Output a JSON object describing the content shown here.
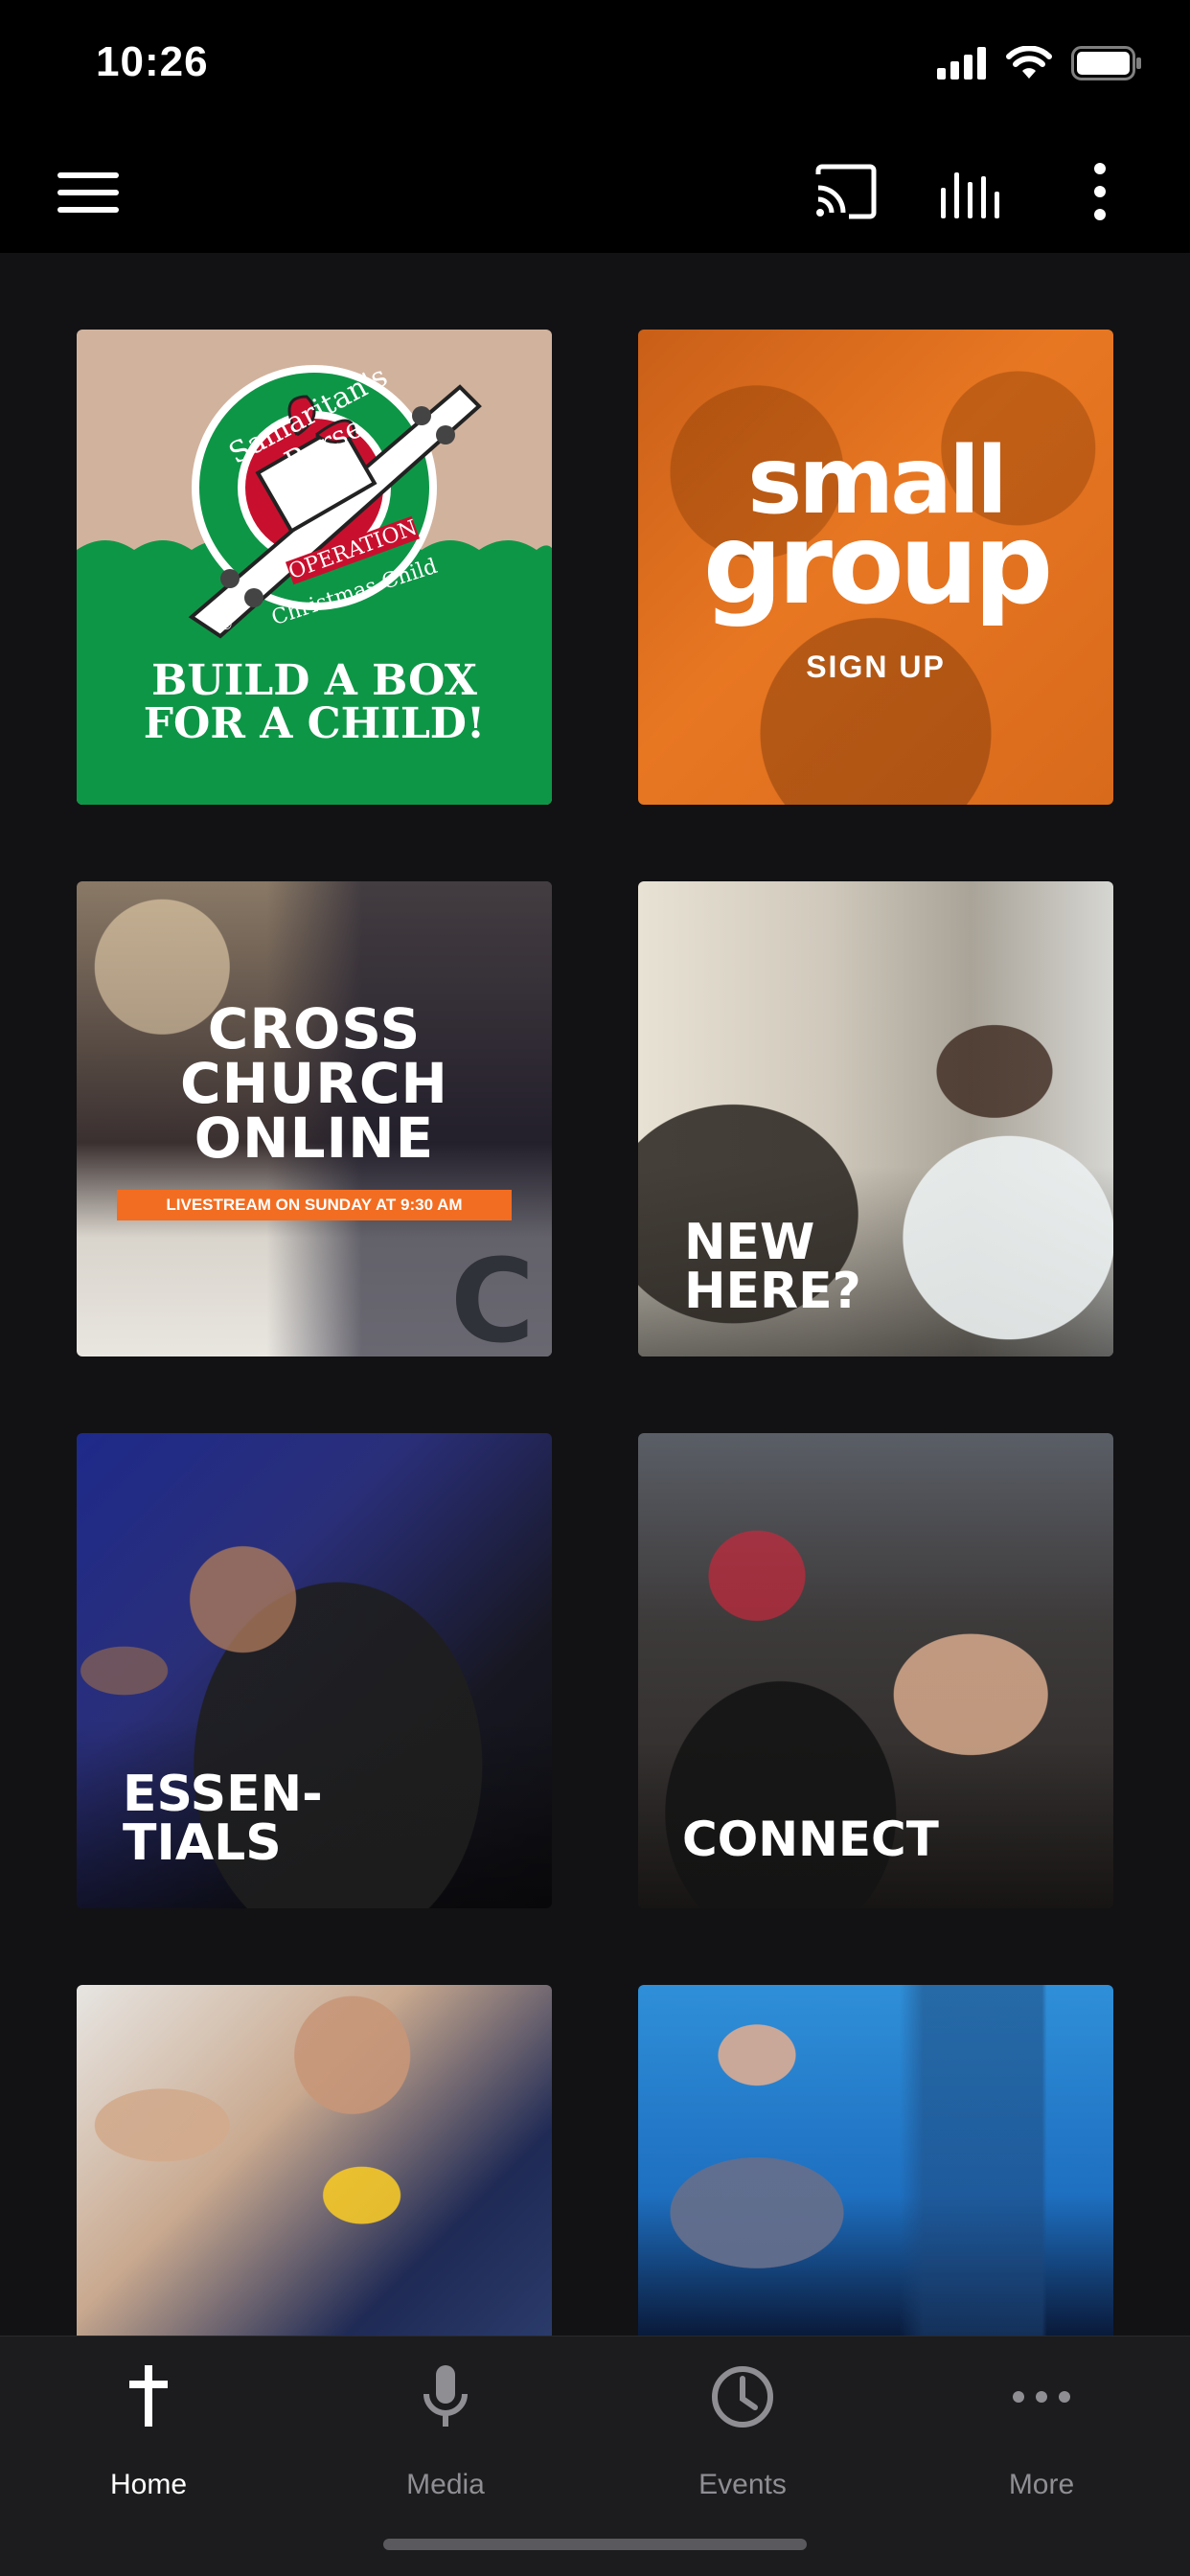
{
  "status_bar": {
    "time": "10:26"
  },
  "app_bar": {
    "menu_icon": "hamburger-menu-icon",
    "cast_icon": "cast-icon",
    "audio_icon": "audio-bars-icon",
    "more_icon": "vertical-dots-icon"
  },
  "tiles": [
    {
      "id": "operation-christmas-child",
      "arc_top": "Samaritan's Purse",
      "arc_mid": "OPERATION",
      "arc_bottom": "Christmas Child",
      "reg": "®",
      "tagline": "BUILD A BOX\nFOR A CHILD!"
    },
    {
      "id": "small-group",
      "line1": "small",
      "line2": "group",
      "sub": "SIGN UP"
    },
    {
      "id": "cross-church-online",
      "title": "CROSS\nCHURCH\nONLINE",
      "banner": "LIVESTREAM ON SUNDAY AT 9:30 AM"
    },
    {
      "id": "new-here",
      "title": "NEW\nHERE?"
    },
    {
      "id": "essentials",
      "title": "ESSEN-\nTIALS"
    },
    {
      "id": "connect",
      "title": "CONNECT"
    },
    {
      "id": "kids",
      "title": ""
    },
    {
      "id": "sermon",
      "title": ""
    }
  ],
  "tab_bar": {
    "tabs": [
      {
        "label": "Home",
        "icon": "cross-icon",
        "active": true
      },
      {
        "label": "Media",
        "icon": "microphone-icon",
        "active": false
      },
      {
        "label": "Events",
        "icon": "clock-icon",
        "active": false
      },
      {
        "label": "More",
        "icon": "horizontal-dots-icon",
        "active": false
      }
    ]
  },
  "colors": {
    "background": "#121214",
    "bar": "#000000",
    "tab_bar": "#1c1c1e",
    "occ_green": "#0e9647",
    "occ_tan": "#d1b29d",
    "small_group_orange": "#e87722",
    "banner_orange": "#f26d21",
    "inactive": "#8e8e93"
  }
}
